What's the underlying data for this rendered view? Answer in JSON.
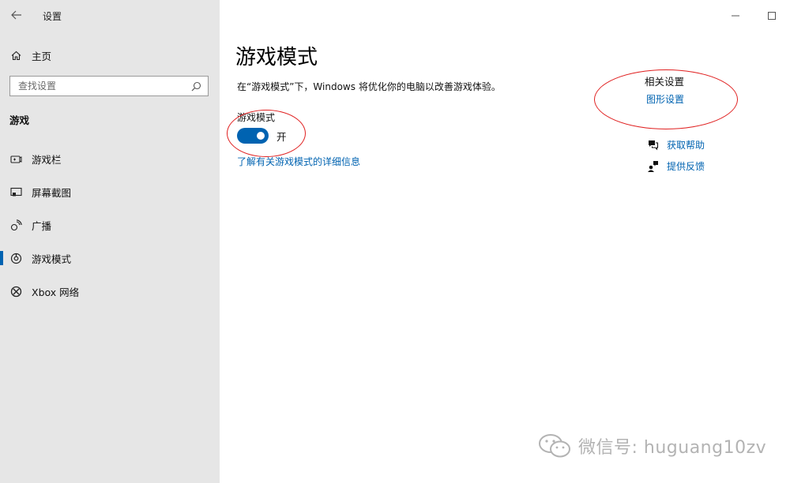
{
  "app": {
    "title": "设置"
  },
  "sidebar": {
    "home_label": "主页",
    "search_placeholder": "查找设置",
    "section_title": "游戏",
    "items": [
      {
        "label": "游戏栏",
        "icon": "game-bar-icon",
        "active": false
      },
      {
        "label": "屏幕截图",
        "icon": "screen-capture-icon",
        "active": false
      },
      {
        "label": "广播",
        "icon": "broadcast-icon",
        "active": false
      },
      {
        "label": "游戏模式",
        "icon": "game-mode-icon",
        "active": true
      },
      {
        "label": "Xbox 网络",
        "icon": "xbox-icon",
        "active": false
      }
    ]
  },
  "main": {
    "title": "游戏模式",
    "description": "在“游戏模式”下，Windows 将优化你的电脑以改善游戏体验。",
    "toggle": {
      "label": "游戏模式",
      "state_label": "开",
      "on": true
    },
    "more_link": "了解有关游戏模式的详细信息"
  },
  "related": {
    "title": "相关设置",
    "graphics_link": "图形设置",
    "help_label": "获取帮助",
    "feedback_label": "提供反馈"
  },
  "watermark": {
    "text": "微信号: huguang10zv"
  },
  "colors": {
    "accent": "#0063b1",
    "sidebar_bg": "#e6e6e6",
    "annotation": "#e02020"
  }
}
